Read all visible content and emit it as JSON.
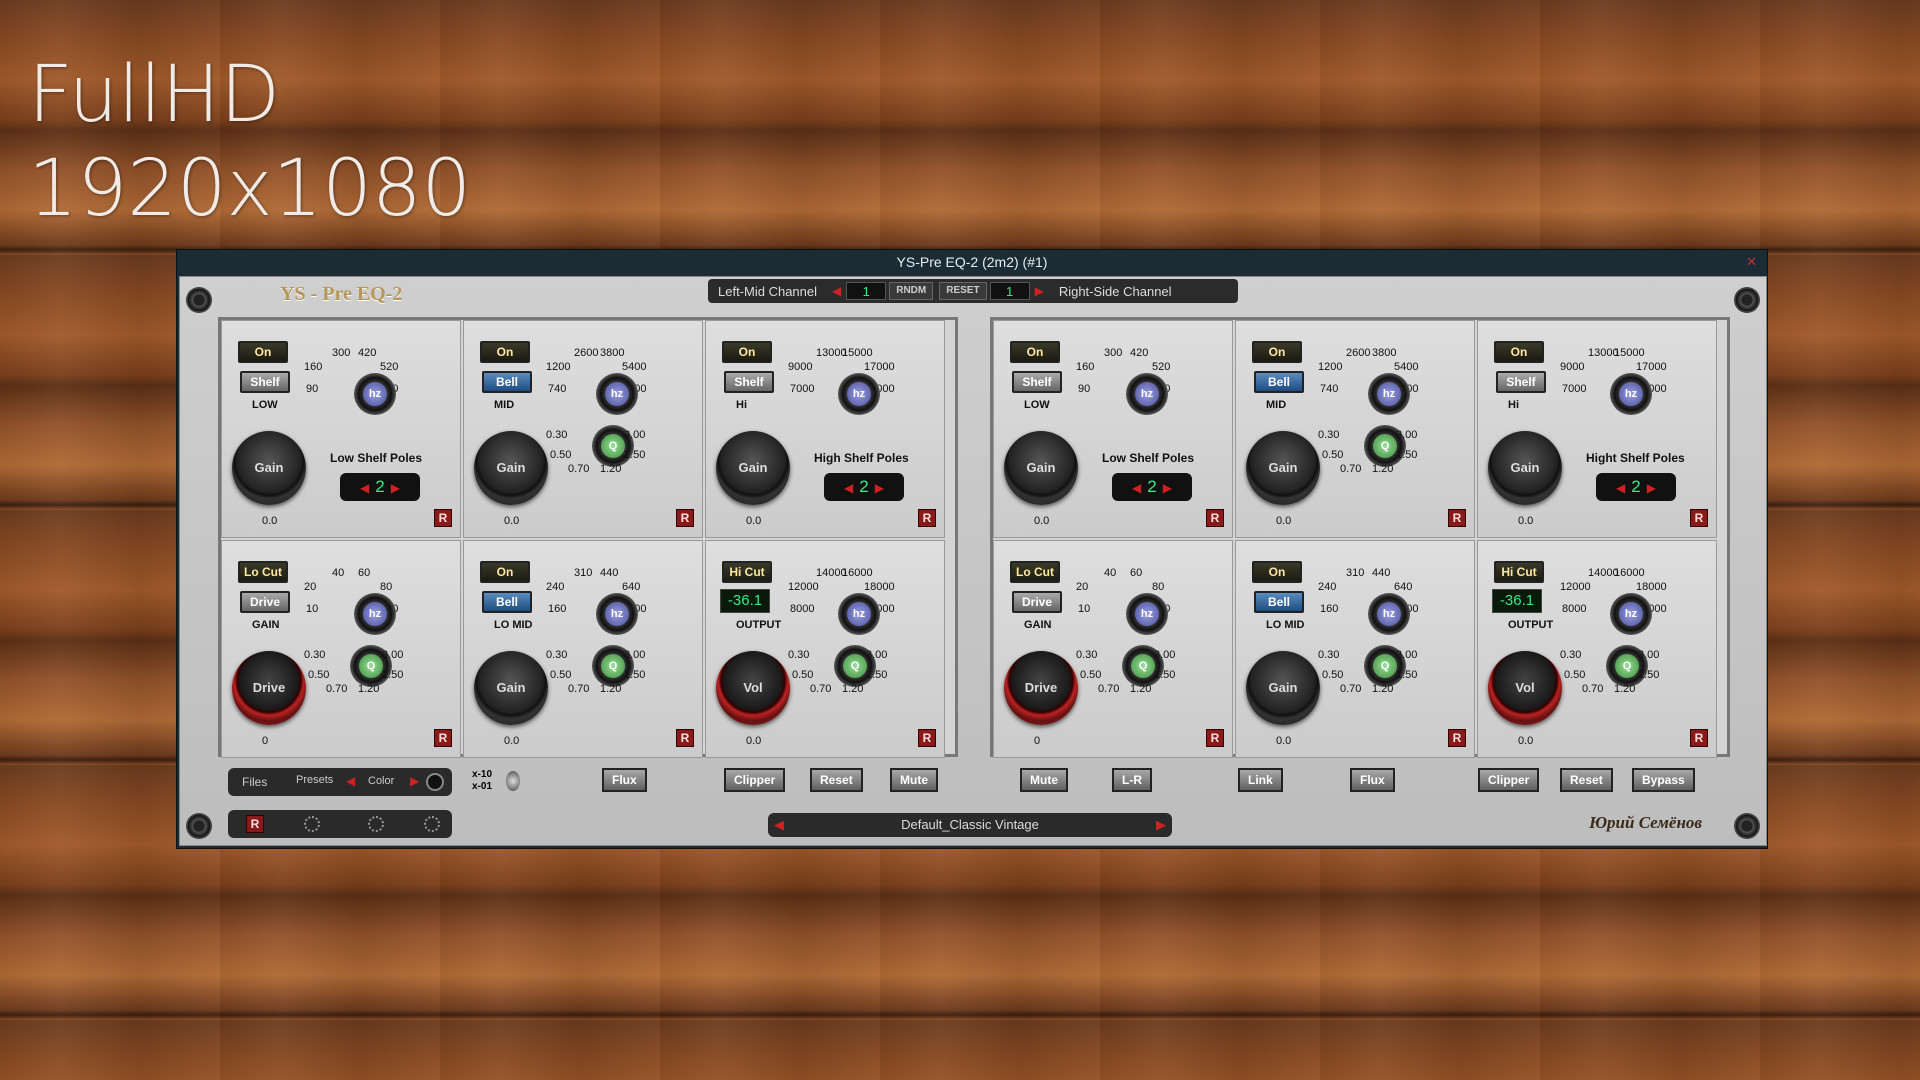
{
  "overlay": {
    "line1": "FullHD",
    "line2": "1920x1080"
  },
  "window": {
    "title": "YS-Pre EQ-2 (2m2) (#1)"
  },
  "brand": {
    "logo": "YS - Pre EQ-2",
    "signature": "Юрий Семёнов"
  },
  "channelbar": {
    "left": "Left-Mid Channel",
    "left_num": "1",
    "rndm": "RNDM",
    "reset": "RESET",
    "right_num": "1",
    "right": "Right-Side Channel"
  },
  "channels": [
    {
      "low": {
        "on": "On",
        "mode": "Shelf",
        "name": "LOW",
        "freqs": [
          "300",
          "420",
          "160",
          "520",
          "90",
          "600"
        ],
        "gain": "Gain",
        "gain_val": "0.0",
        "poles_label": "Low Shelf Poles",
        "poles": "2",
        "r": "R"
      },
      "mid": {
        "on": "On",
        "mode": "Bell",
        "name": "MID",
        "freqs": [
          "2600",
          "3800",
          "1200",
          "5400",
          "740",
          "7000"
        ],
        "gain": "Gain",
        "gain_val": "0.0",
        "qs": [
          "0.30",
          "3.00",
          "0.50",
          "1.50",
          "0.70",
          "1.20"
        ],
        "r": "R"
      },
      "hi": {
        "on": "On",
        "mode": "Shelf",
        "name": "Hi",
        "freqs": [
          "13000",
          "15000",
          "9000",
          "17000",
          "7000",
          "22000"
        ],
        "gain": "Gain",
        "gain_val": "0.0",
        "poles_label": "High Shelf Poles",
        "poles": "2",
        "r": "R"
      },
      "locut": {
        "on": "Lo Cut",
        "mode": "Drive",
        "name": "GAIN",
        "freqs": [
          "40",
          "60",
          "20",
          "80",
          "10",
          "120"
        ],
        "knob": "Drive",
        "knob_val": "0",
        "qs": [
          "0.30",
          "3.00",
          "0.50",
          "1.50",
          "0.70",
          "1.20"
        ],
        "r": "R"
      },
      "lomid": {
        "on": "On",
        "mode": "Bell",
        "name": "LO MID",
        "freqs": [
          "310",
          "440",
          "240",
          "640",
          "160",
          "1600"
        ],
        "gain": "Gain",
        "gain_val": "0.0",
        "qs": [
          "0.30",
          "3.00",
          "0.50",
          "1.50",
          "0.70",
          "1.20"
        ],
        "r": "R"
      },
      "hicut": {
        "on": "Hi Cut",
        "display": "-36.1",
        "name": "OUTPUT",
        "freqs": [
          "14000",
          "16000",
          "12000",
          "18000",
          "8000",
          "22000"
        ],
        "knob": "Vol",
        "knob_val": "0.0",
        "qs": [
          "0.30",
          "3.00",
          "0.50",
          "1.50",
          "0.70",
          "1.20"
        ],
        "r": "R"
      }
    },
    {
      "low": {
        "on": "On",
        "mode": "Shelf",
        "name": "LOW",
        "freqs": [
          "300",
          "420",
          "160",
          "520",
          "90",
          "600"
        ],
        "gain": "Gain",
        "gain_val": "0.0",
        "poles_label": "Low Shelf Poles",
        "poles": "2",
        "r": "R"
      },
      "mid": {
        "on": "On",
        "mode": "Bell",
        "name": "MID",
        "freqs": [
          "2600",
          "3800",
          "1200",
          "5400",
          "740",
          "7000"
        ],
        "gain": "Gain",
        "gain_val": "0.0",
        "qs": [
          "0.30",
          "3.00",
          "0.50",
          "1.50",
          "0.70",
          "1.20"
        ],
        "r": "R"
      },
      "hi": {
        "on": "On",
        "mode": "Shelf",
        "name": "Hi",
        "freqs": [
          "13000",
          "15000",
          "9000",
          "17000",
          "7000",
          "22000"
        ],
        "gain": "Gain",
        "gain_val": "0.0",
        "poles_label": "Hight Shelf Poles",
        "poles": "2",
        "r": "R"
      },
      "locut": {
        "on": "Lo Cut",
        "mode": "Drive",
        "name": "GAIN",
        "freqs": [
          "40",
          "60",
          "20",
          "80",
          "10",
          "120"
        ],
        "knob": "Drive",
        "knob_val": "0",
        "qs": [
          "0.30",
          "3.00",
          "0.50",
          "1.50",
          "0.70",
          "1.20"
        ],
        "r": "R"
      },
      "lomid": {
        "on": "On",
        "mode": "Bell",
        "name": "LO MID",
        "freqs": [
          "310",
          "440",
          "240",
          "640",
          "160",
          "1600"
        ],
        "gain": "Gain",
        "gain_val": "0.0",
        "qs": [
          "0.30",
          "3.00",
          "0.50",
          "1.50",
          "0.70",
          "1.20"
        ],
        "r": "R"
      },
      "hicut": {
        "on": "Hi Cut",
        "display": "-36.1",
        "name": "OUTPUT",
        "freqs": [
          "14000",
          "16000",
          "12000",
          "18000",
          "8000",
          "22000"
        ],
        "knob": "Vol",
        "knob_val": "0.0",
        "qs": [
          "0.30",
          "3.00",
          "0.50",
          "1.50",
          "0.70",
          "1.20"
        ],
        "r": "R"
      }
    }
  ],
  "files": {
    "files": "Files",
    "presets": "Presets",
    "color": "Color",
    "x10": "x-10",
    "x01": "x-01"
  },
  "toolbar": [
    "Flux",
    "Clipper",
    "Reset",
    "Mute",
    "Mute",
    "L-R",
    "Link",
    "Flux",
    "Clipper",
    "Reset",
    "Bypass"
  ],
  "rbar": {
    "r": "R"
  },
  "preset": {
    "name": "Default_Classic Vintage"
  },
  "icons": {
    "arrow_left": "◀",
    "arrow_right": "▶",
    "close": "✕"
  }
}
